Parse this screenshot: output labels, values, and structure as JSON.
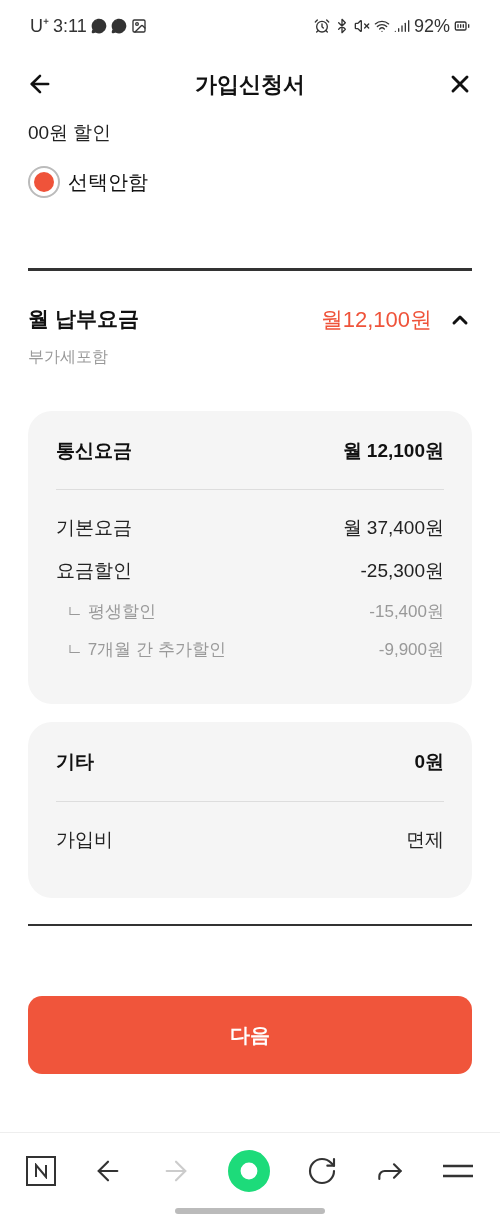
{
  "status_bar": {
    "carrier": "U⁺",
    "time": "3:11",
    "battery": "92%"
  },
  "header": {
    "title": "가입신청서"
  },
  "partial_text": "00원 할인",
  "radio": {
    "label": "선택안함",
    "selected": true
  },
  "summary": {
    "title": "월 납부요금",
    "subtitle": "부가세포함",
    "amount": "월12,100원",
    "expanded": true
  },
  "cards": [
    {
      "rows": [
        {
          "kind": "header",
          "label": "통신요금",
          "value": "월 12,100원"
        },
        {
          "kind": "item",
          "label": "기본요금",
          "value": "월 37,400원"
        },
        {
          "kind": "item",
          "label": "요금할인",
          "value": "-25,300원"
        },
        {
          "kind": "sub",
          "label": "ㄴ 평생할인",
          "value": "-15,400원"
        },
        {
          "kind": "sub",
          "label": "ㄴ 7개월 간 추가할인",
          "value": "-9,900원"
        }
      ]
    },
    {
      "rows": [
        {
          "kind": "header",
          "label": "기타",
          "value": "0원"
        },
        {
          "kind": "item",
          "label": "가입비",
          "value": "면제"
        }
      ]
    }
  ],
  "next_button": "다음",
  "browser_bar": {
    "forward_disabled": true
  }
}
